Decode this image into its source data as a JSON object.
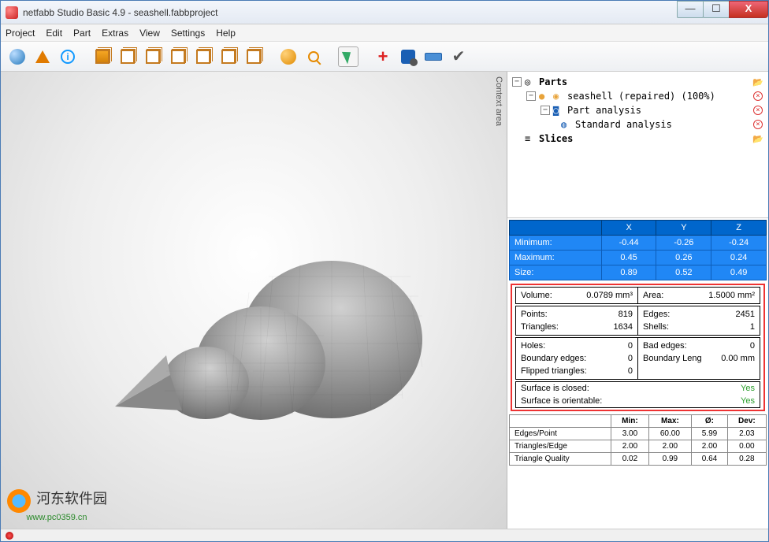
{
  "window": {
    "title": "netfabb Studio Basic 4.9 - seashell.fabbproject"
  },
  "menu": [
    "Project",
    "Edit",
    "Part",
    "Extras",
    "View",
    "Settings",
    "Help"
  ],
  "context_label": "Context area",
  "tree": {
    "parts_label": "Parts",
    "part_name": "seashell (repaired) (100%)",
    "analysis_label": "Part analysis",
    "std_analysis": "Standard analysis",
    "slices_label": "Slices"
  },
  "dims": {
    "headers": [
      "X",
      "Y",
      "Z"
    ],
    "rows": [
      {
        "label": "Minimum:",
        "x": "-0.44",
        "y": "-0.26",
        "z": "-0.24"
      },
      {
        "label": "Maximum:",
        "x": "0.45",
        "y": "0.26",
        "z": "0.24"
      },
      {
        "label": "Size:",
        "x": "0.89",
        "y": "0.52",
        "z": "0.49"
      }
    ]
  },
  "info": {
    "volume_label": "Volume:",
    "volume": "0.0789 mm³",
    "area_label": "Area:",
    "area": "1.5000 mm²",
    "points_label": "Points:",
    "points": "819",
    "edges_label": "Edges:",
    "edges": "2451",
    "triangles_label": "Triangles:",
    "triangles": "1634",
    "shells_label": "Shells:",
    "shells": "1",
    "holes_label": "Holes:",
    "holes": "0",
    "badedges_label": "Bad edges:",
    "badedges": "0",
    "boundaryedges_label": "Boundary edges:",
    "boundaryedges": "0",
    "boundarylen_label": "Boundary Leng",
    "boundarylen": "0.00 mm",
    "flipped_label": "Flipped triangles:",
    "flipped": "0",
    "closed_label": "Surface is closed:",
    "closed": "Yes",
    "orientable_label": "Surface is orientable:",
    "orientable": "Yes"
  },
  "stats": {
    "headers": [
      "Min:",
      "Max:",
      "Ø:",
      "Dev:"
    ],
    "rows": [
      {
        "label": "Edges/Point",
        "min": "3.00",
        "max": "60.00",
        "avg": "5.99",
        "dev": "2.03"
      },
      {
        "label": "Triangles/Edge",
        "min": "2.00",
        "max": "2.00",
        "avg": "2.00",
        "dev": "0.00"
      },
      {
        "label": "Triangle Quality",
        "min": "0.02",
        "max": "0.99",
        "avg": "0.64",
        "dev": "0.28"
      }
    ]
  },
  "watermark": {
    "text": "河东软件园",
    "url": "www.pc0359.cn"
  }
}
